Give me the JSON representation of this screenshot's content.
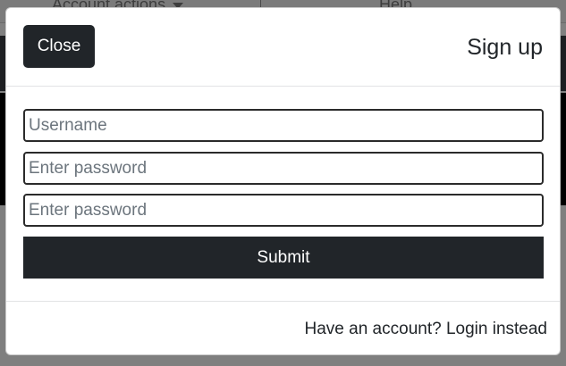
{
  "background": {
    "nav_account": "Account actions",
    "nav_help": "Help"
  },
  "modal": {
    "close_label": "Close",
    "title": "Sign up",
    "username": {
      "value": "",
      "placeholder": "Username"
    },
    "password": {
      "value": "",
      "placeholder": "Enter password"
    },
    "password_confirm": {
      "value": "",
      "placeholder": "Enter password"
    },
    "submit_label": "Submit",
    "footer_link": "Have an account? Login instead"
  },
  "colors": {
    "dark_button": "#212529",
    "overlay": "#808080",
    "modal_bg": "#ffffff"
  }
}
